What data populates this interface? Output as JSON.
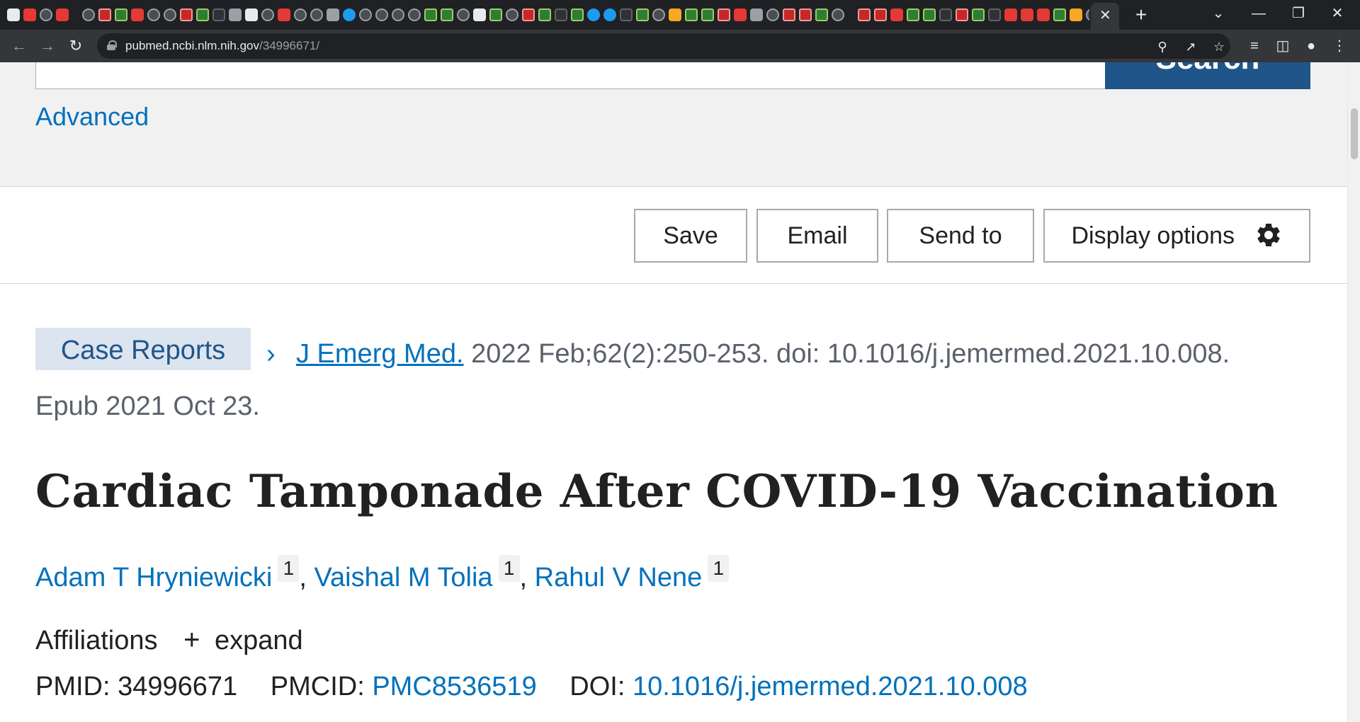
{
  "browser": {
    "url_host": "pubmed.ncbi.nlm.nih.gov",
    "url_path": "/34996671/",
    "active_tab_close": "✕",
    "new_tab": "+",
    "window_controls": {
      "dropdown": "⌄",
      "minimize": "—",
      "restore": "❐",
      "close": "✕"
    },
    "icons": [
      "back-icon",
      "forward-icon",
      "reload-icon",
      "lock-icon",
      "zoom-icon",
      "share-icon",
      "bookmark-star-icon",
      "reading-list-icon",
      "side-panel-icon",
      "profile-icon",
      "menu-icon"
    ]
  },
  "search": {
    "button_label": "Search",
    "advanced_label": "Advanced"
  },
  "actions": {
    "save": "Save",
    "email": "Email",
    "send_to": "Send to",
    "display_options": "Display options"
  },
  "article": {
    "publication_type": "Case Reports",
    "journal": "J Emerg Med.",
    "citation": " 2022 Feb;62(2):250-253. doi: 10.1016/j.jemermed.2021.10.008.",
    "epub": "Epub 2021 Oct 23.",
    "title": "Cardiac Tamponade After COVID-19 Vaccination",
    "authors": [
      {
        "name": "Adam T Hryniewicki",
        "aff": "1"
      },
      {
        "name": "Vaishal M Tolia",
        "aff": "1"
      },
      {
        "name": "Rahul V Nene",
        "aff": "1"
      }
    ],
    "affiliations_label": "Affiliations",
    "expand_label": "expand",
    "pmid_label": "PMID:",
    "pmid": "34996671",
    "pmcid_label": "PMCID:",
    "pmcid": "PMC8536519",
    "doi_label": "DOI:",
    "doi": "10.1016/j.jemermed.2021.10.008"
  },
  "colors": {
    "link": "#0071bc",
    "search_button": "#20558a",
    "pubtype_bg": "#dbe4ef",
    "chrome_dark": "#202124"
  }
}
